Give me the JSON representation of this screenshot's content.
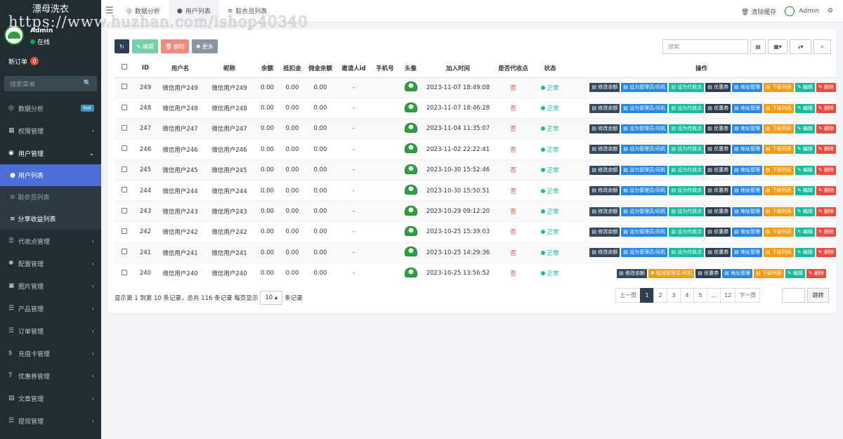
{
  "watermark": {
    "title": "漂母洗衣",
    "url": "https://www.huzhan.com/ishop40340"
  },
  "sidebar": {
    "user_name": "Admin",
    "online": "在线",
    "new_orders_label": "新订单",
    "new_orders_count": "0",
    "search_placeholder": "搜索菜单",
    "search_icon": "🔍",
    "menu": [
      {
        "label": "数据分析",
        "icon": "dashboard-icon",
        "glyph": "◎",
        "badge": "hot"
      },
      {
        "label": "权限管理",
        "icon": "users-icon",
        "glyph": "▦"
      },
      {
        "label": "用户管理",
        "icon": "user-circle-icon",
        "glyph": "◉",
        "open": true
      },
      {
        "label": "用户列表",
        "sub": true,
        "glyph": "●"
      },
      {
        "label": "取衣员列表",
        "sub": true,
        "glyph": "≡"
      },
      {
        "label": "分享收益列表",
        "sub": true,
        "glyph": "≡"
      },
      {
        "label": "代收点管理",
        "icon": "list-icon",
        "glyph": "☰"
      },
      {
        "label": "配置管理",
        "icon": "gear-icon",
        "glyph": "✱"
      },
      {
        "label": "图片管理",
        "icon": "image-icon",
        "glyph": "▣"
      },
      {
        "label": "产品管理",
        "icon": "list-icon",
        "glyph": "☰"
      },
      {
        "label": "订单管理",
        "icon": "list-icon",
        "glyph": "☰"
      },
      {
        "label": "充值卡管理",
        "icon": "dollar-icon",
        "glyph": "$"
      },
      {
        "label": "优惠券管理",
        "icon": "text-icon",
        "glyph": "T"
      },
      {
        "label": "文章管理",
        "icon": "file-icon",
        "glyph": "▤"
      },
      {
        "label": "提现管理",
        "icon": "list-icon",
        "glyph": "☰"
      }
    ]
  },
  "topbar": {
    "tabs": [
      "数据分析",
      "用户列表",
      "取衣员列表"
    ],
    "clear_cache": "清除缓存",
    "admin": "Admin"
  },
  "toolbar": {
    "refresh_icon": "↻",
    "edit": "编辑",
    "delete": "删除",
    "more": "更多",
    "search_placeholder": "搜索"
  },
  "table": {
    "headers": [
      "",
      "ID",
      "用户名",
      "昵称",
      "余额",
      "抵扣金",
      "佣金余额",
      "邀请人id",
      "手机号",
      "头像",
      "加入时间",
      "是否代收点",
      "状态",
      "操作"
    ],
    "rows": [
      {
        "id": "249",
        "username": "微信用户249",
        "nickname": "微信用户249",
        "balance": "0.00",
        "deduct": "0.00",
        "commission": "0.00",
        "inviter": "-",
        "phone": "",
        "time": "2023-11-07 18:49:08",
        "agent": "否",
        "status": "正常",
        "admin_btn": "设为管理员/司机"
      },
      {
        "id": "248",
        "username": "微信用户248",
        "nickname": "微信用户248",
        "balance": "0.00",
        "deduct": "0.00",
        "commission": "0.00",
        "inviter": "-",
        "phone": "",
        "time": "2023-11-07 18:46:28",
        "agent": "否",
        "status": "正常",
        "admin_btn": "设为管理员/司机"
      },
      {
        "id": "247",
        "username": "微信用户247",
        "nickname": "微信用户247",
        "balance": "0.00",
        "deduct": "0.00",
        "commission": "0.00",
        "inviter": "-",
        "phone": "",
        "time": "2023-11-04 11:35:07",
        "agent": "否",
        "status": "正常",
        "admin_btn": "设为管理员/司机"
      },
      {
        "id": "246",
        "username": "微信用户246",
        "nickname": "微信用户246",
        "balance": "0.00",
        "deduct": "0.00",
        "commission": "0.00",
        "inviter": "-",
        "phone": "",
        "time": "2023-11-02 22:22:41",
        "agent": "否",
        "status": "正常",
        "admin_btn": "设为管理员/司机"
      },
      {
        "id": "245",
        "username": "微信用户245",
        "nickname": "微信用户245",
        "balance": "0.00",
        "deduct": "0.00",
        "commission": "0.00",
        "inviter": "-",
        "phone": "",
        "time": "2023-10-30 15:52:46",
        "agent": "否",
        "status": "正常",
        "admin_btn": "设为管理员/司机"
      },
      {
        "id": "244",
        "username": "微信用户244",
        "nickname": "微信用户244",
        "balance": "0.00",
        "deduct": "0.00",
        "commission": "0.00",
        "inviter": "-",
        "phone": "",
        "time": "2023-10-30 15:50:51",
        "agent": "否",
        "status": "正常",
        "admin_btn": "设为管理员/司机"
      },
      {
        "id": "243",
        "username": "微信用户243",
        "nickname": "微信用户243",
        "balance": "0.00",
        "deduct": "0.00",
        "commission": "0.00",
        "inviter": "-",
        "phone": "",
        "time": "2023-10-29 09:12:20",
        "agent": "否",
        "status": "正常",
        "admin_btn": "设为管理员/司机"
      },
      {
        "id": "242",
        "username": "微信用户242",
        "nickname": "微信用户242",
        "balance": "0.00",
        "deduct": "0.00",
        "commission": "0.00",
        "inviter": "-",
        "phone": "",
        "time": "2023-10-25 15:39:03",
        "agent": "否",
        "status": "正常",
        "admin_btn": "设为管理员/司机"
      },
      {
        "id": "241",
        "username": "微信用户241",
        "nickname": "微信用户241",
        "balance": "0.00",
        "deduct": "0.00",
        "commission": "0.00",
        "inviter": "-",
        "phone": "",
        "time": "2023-10-25 14:29:36",
        "agent": "否",
        "status": "正常",
        "admin_btn": "设为管理员/司机"
      },
      {
        "id": "240",
        "username": "微信用户240",
        "nickname": "微信用户240",
        "balance": "0.00",
        "deduct": "0.00",
        "commission": "0.00",
        "inviter": "-",
        "phone": "",
        "time": "2023-10-25 13:56:52",
        "agent": "否",
        "status": "正常",
        "admin_btn": "取消管理员/司机",
        "cancel": true
      }
    ],
    "op_labels": {
      "edit_balance": "修改余额",
      "set_agent": "设为代收点",
      "coupon": "优惠券",
      "address": "地址管理",
      "subordinates": "下级列表",
      "edit": "编辑",
      "delete": "删除"
    }
  },
  "footer": {
    "info": "显示第 1 到第 10 条记录，总共 116 条记录 每页显示",
    "page_size": "10",
    "suffix": "条记录",
    "pages": [
      "上一页",
      "1",
      "2",
      "3",
      "4",
      "5",
      "...",
      "12",
      "下一页"
    ],
    "active_page": "1",
    "jump": "跳转"
  },
  "colors": {
    "sidebar_bg": "#222d32",
    "active_item": "#4b6fd6",
    "primary_dark": "#2c3e50",
    "success": "#18bc9c",
    "danger": "#e74c3c",
    "warning": "#f39c12",
    "info": "#2a88e0"
  }
}
